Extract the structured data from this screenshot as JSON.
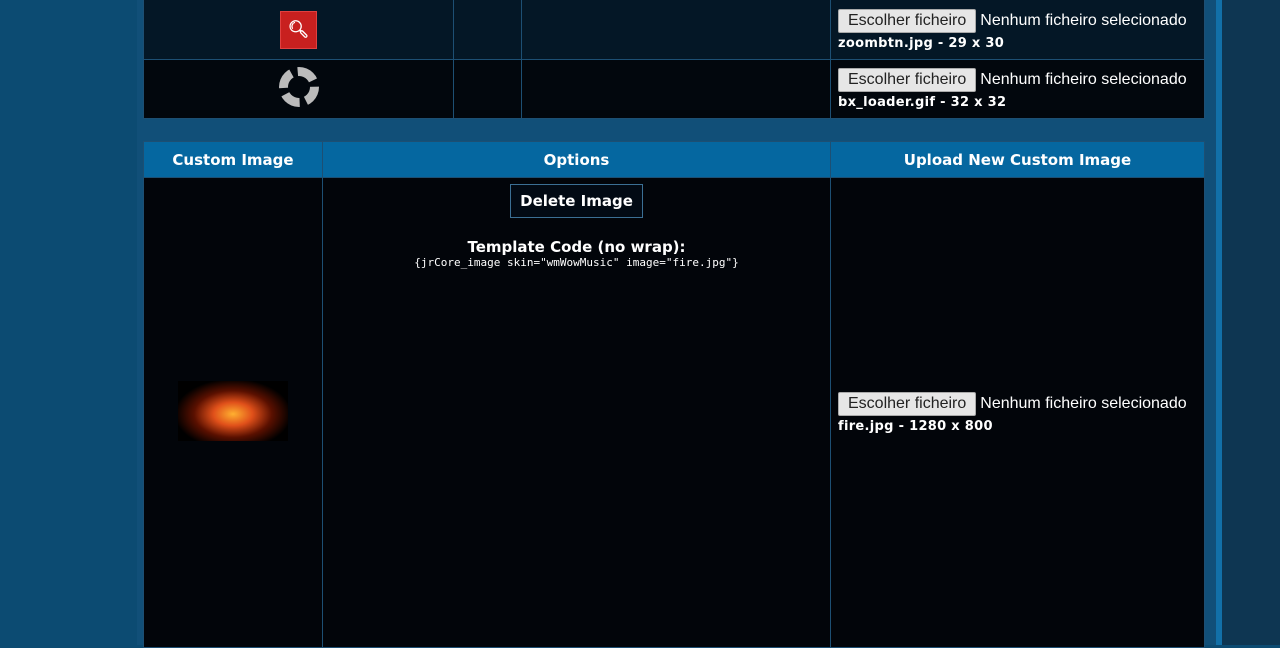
{
  "system_images": [
    {
      "icon": "zoom-button",
      "choose_label": "Escolher ficheiro",
      "no_file": "Nenhum ficheiro selecionado",
      "file_info": "zoombtn.jpg - 29 x 30"
    },
    {
      "icon": "loader-spinner",
      "choose_label": "Escolher ficheiro",
      "no_file": "Nenhum ficheiro selecionado",
      "file_info": "bx_loader.gif - 32 x 32"
    }
  ],
  "custom_images": {
    "headers": [
      "Custom Image",
      "Options",
      "Upload New Custom Image"
    ],
    "rows": [
      {
        "delete_label": "Delete Image",
        "template_code_label": "Template Code (no wrap):",
        "template_code": "{jrCore_image skin=\"wmWowMusic\" image=\"fire.jpg\"}",
        "choose_label": "Escolher ficheiro",
        "no_file": "Nenhum ficheiro selecionado",
        "file_info": "fire.jpg - 1280 x 800"
      }
    ]
  },
  "colors": {
    "header": "#0567a0",
    "background": "#0c4b72",
    "zoom_button": "#c8201f"
  }
}
